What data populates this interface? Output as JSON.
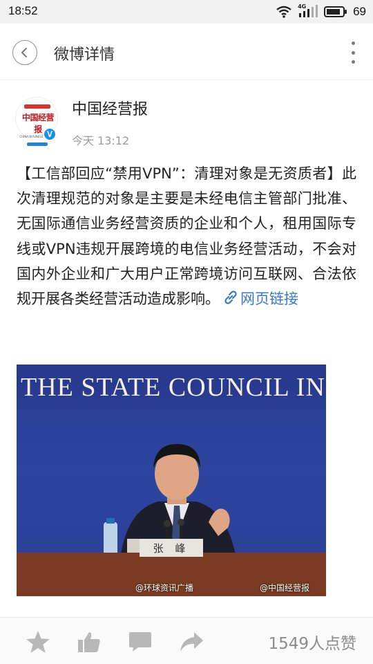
{
  "status_bar": {
    "time": "18:52",
    "network": "4G",
    "battery": "69"
  },
  "header": {
    "title": "微博详情",
    "back_icon": "chevron-left-icon",
    "more_icon": "more-vertical-icon"
  },
  "author": {
    "name": "中国经营报",
    "time": "今天 13:12",
    "verified": "V",
    "avatar_text": "中国经营报",
    "avatar_subtext": "CHINA BUSINESS JOURNAL"
  },
  "post": {
    "text": "【工信部回应“禁用VPN”：清理对象是无资质者】此次清理规范的对象是主要是未经电信主管部门批准、无国际通信业务经营资质的企业和个人，租用国际专线或VPN违规开展跨境的电信业务经营活动，不会对国内外企业和广大用户正常跨境访问互联网、合法依规开展各类经营活动造成影响。",
    "link_label": "网页链接",
    "link_icon": "link-icon"
  },
  "image": {
    "banner": "THE STATE COUNCIL INFORM",
    "nameplate": "张 峰",
    "watermark_left": "@环球资讯广播",
    "watermark_right": "@中国经营报"
  },
  "bottom_bar": {
    "like_count": "1549人点赞",
    "icons": [
      "star-icon",
      "thumbs-up-icon",
      "comment-icon",
      "share-icon"
    ]
  },
  "colors": {
    "link": "#3a78c5",
    "verified": "#1e8fe8",
    "icon_gray": "#b5b5b5"
  }
}
